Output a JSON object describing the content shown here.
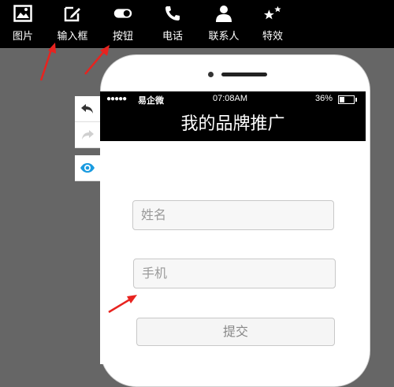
{
  "toolbar": {
    "items": [
      {
        "label": "图片",
        "icon": "image-icon"
      },
      {
        "label": "输入框",
        "icon": "edit-icon"
      },
      {
        "label": "按钮",
        "icon": "toggle-icon"
      },
      {
        "label": "电话",
        "icon": "phone-icon"
      },
      {
        "label": "联系人",
        "icon": "contact-icon"
      },
      {
        "label": "特效",
        "icon": "stars-icon"
      }
    ]
  },
  "side_controls": [
    {
      "icon": "undo-icon"
    },
    {
      "icon": "redo-icon"
    },
    {
      "icon": "eye-icon"
    }
  ],
  "phone": {
    "status_bar": {
      "signal": "●●●●●",
      "carrier": "易企微",
      "time": "07:08AM",
      "battery": "36%",
      "battery_level": 0.36
    },
    "page_title": "我的品牌推广",
    "form": {
      "name_placeholder": "姓名",
      "phone_placeholder": "手机",
      "submit_label": "提交"
    }
  },
  "colors": {
    "background": "#666666",
    "toolbar": "#000000",
    "annotation_arrow": "#e8231f",
    "eye_icon": "#1a9be0"
  }
}
